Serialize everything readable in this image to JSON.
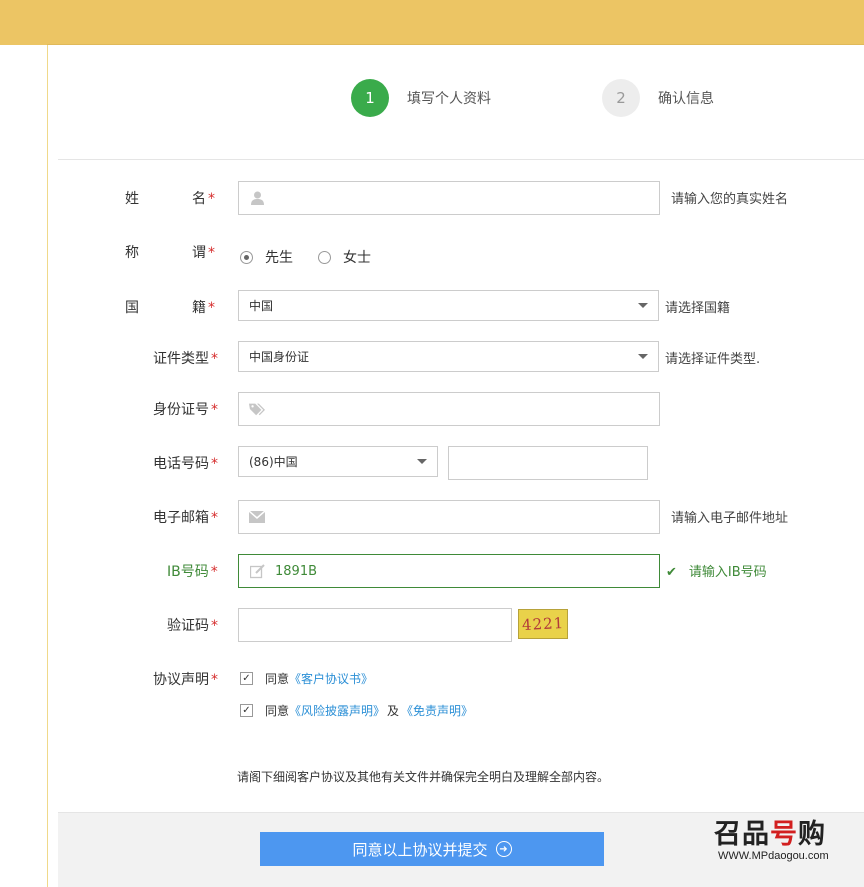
{
  "steps": [
    {
      "number": "1",
      "label": "填写个人资料",
      "state": "active"
    },
    {
      "number": "2",
      "label": "确认信息",
      "state": "idle"
    }
  ],
  "required_mark": "*",
  "form": {
    "name": {
      "label_chars": [
        "姓",
        "名"
      ],
      "hint": "请输入您的真实姓名",
      "icon": "user-icon"
    },
    "title": {
      "label_chars": [
        "称",
        "谓"
      ],
      "options": [
        {
          "label": "先生",
          "checked": true
        },
        {
          "label": "女士",
          "checked": false
        }
      ]
    },
    "nationality": {
      "label_chars": [
        "国",
        "籍"
      ],
      "value": "中国",
      "hint": "请选择国籍"
    },
    "id_type": {
      "label": "证件类型",
      "value": "中国身份证",
      "hint": "请选择证件类型."
    },
    "id_number": {
      "label": "身份证号",
      "icon": "tag-icon"
    },
    "phone": {
      "label": "电话号码",
      "country_code": "(86)中国",
      "value": ""
    },
    "email": {
      "label": "电子邮箱",
      "hint": "请输入电子邮件地址",
      "icon": "envelope-icon"
    },
    "ib": {
      "label": "IB号码",
      "value": "1891B",
      "hint": "请输入IB号码",
      "icon": "edit-icon"
    },
    "captcha": {
      "label": "验证码",
      "image_text": "4221"
    },
    "agreement": {
      "label": "协议声明",
      "items": [
        {
          "prefix": "同意",
          "links": [
            "《客户协议书》"
          ],
          "joiner": "",
          "checked": true
        },
        {
          "prefix": "同意",
          "links": [
            "《风险披露声明》",
            "《免责声明》"
          ],
          "joiner": "及",
          "checked": true
        }
      ]
    }
  },
  "notice": "请阁下细阅客户协议及其他有关文件并确保完全明白及理解全部内容。",
  "submit_label": "同意以上协议并提交",
  "watermark": {
    "title_a": "召品",
    "title_b": "号",
    "title_c": "购",
    "url": "WWW.MPdaogou.com"
  },
  "colors": {
    "header": "#ecc564",
    "active_step": "#3aab4b",
    "submit": "#4d97f0",
    "link": "#2b8fd6",
    "valid": "#3f8a38",
    "required": "#d62d2d"
  }
}
